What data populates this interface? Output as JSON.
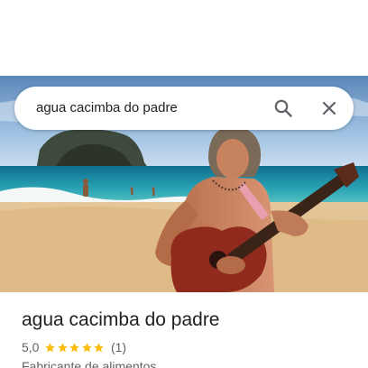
{
  "search": {
    "query": "agua cacimba do padre"
  },
  "place": {
    "title": "agua cacimba do padre",
    "rating": "5,0",
    "stars_filled": 5,
    "stars_total": 5,
    "review_count": "(1)",
    "category": "Fabricante de alimentos"
  },
  "icons": {
    "search": "search-icon",
    "close": "close-icon",
    "star": "star-icon"
  },
  "colors": {
    "star": "#fbbc04",
    "title": "#202124",
    "secondary_text": "#5f6368",
    "icon": "#5f6368"
  }
}
